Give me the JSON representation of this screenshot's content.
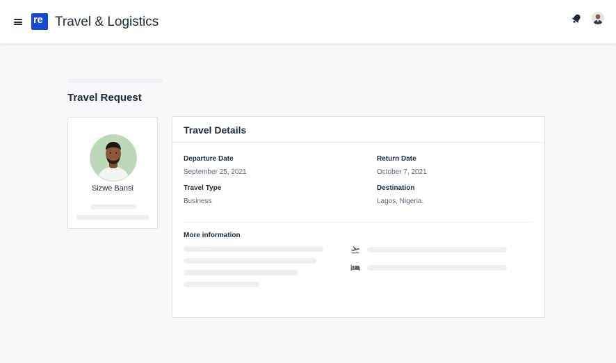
{
  "header": {
    "logo_text": "re",
    "app_title": "Travel & Logistics"
  },
  "page": {
    "title": "Travel Request"
  },
  "profile": {
    "name": "Sizwe Bansi"
  },
  "details": {
    "title": "Travel Details",
    "fields": [
      {
        "label": "Departure Date",
        "value": "September 25, 2021"
      },
      {
        "label": "Return Date",
        "value": "October 7, 2021"
      },
      {
        "label": "Travel Type",
        "value": "Business"
      },
      {
        "label": "Destination",
        "value": "Lagos, Nigeria."
      }
    ],
    "more_info_label": "More information",
    "more_info_icons": [
      "flight-takeoff-icon",
      "hotel-bed-icon"
    ]
  },
  "colors": {
    "brand": "#1747d6",
    "text_primary": "#1b2a3f",
    "text_secondary": "#56667a",
    "background": "#f8f9fb",
    "skeleton": "#eef0f3"
  }
}
